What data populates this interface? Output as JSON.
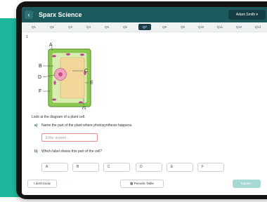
{
  "app": {
    "back_icon": "arrow-left-icon",
    "title": "Sparx Science",
    "user": "Adam Smith ▾"
  },
  "questions": [
    "Q1",
    "Q2",
    "Q3",
    "Q4",
    "Q5",
    "Q6",
    "Q7",
    "Q8",
    "Q9",
    "Q10",
    "Q11",
    "Q12",
    "Q13"
  ],
  "active_question": "Q7",
  "question_number": "1",
  "diagram": {
    "labels": [
      "A",
      "B",
      "C",
      "D",
      "E",
      "F",
      "G"
    ]
  },
  "intro": "Look at the diagram of a plant cell.",
  "part_a": {
    "label": "a)",
    "text": "Name the part of the plant where photosynthesis happens.",
    "placeholder": "Enter answer..."
  },
  "part_b": {
    "label": "b)",
    "text": "Which label shows this part of the cell?",
    "options": [
      "A",
      "B",
      "C",
      "D",
      "E",
      "F"
    ]
  },
  "footer": {
    "dont_know": "I don't know",
    "periodic_table": "Periodic Table",
    "submit": "Submit ›"
  },
  "colors": {
    "accent": "#1d5a5e",
    "brand_teal": "#1fb79c",
    "error_border": "#e58b8b"
  }
}
